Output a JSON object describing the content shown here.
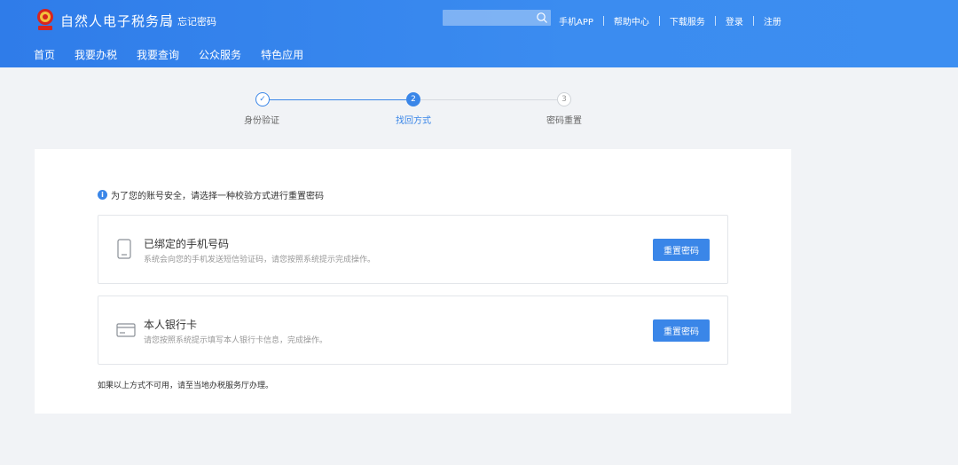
{
  "header": {
    "site_title": "自然人电子税务局",
    "sub_title": "忘记密码",
    "search": {
      "placeholder": ""
    },
    "top_links": [
      "手机APP",
      "帮助中心",
      "下载服务",
      "登录",
      "注册"
    ],
    "nav": [
      "首页",
      "我要办税",
      "我要查询",
      "公众服务",
      "特色应用"
    ]
  },
  "steps": {
    "items": [
      {
        "label": "身份验证",
        "marker": "✓",
        "state": "done"
      },
      {
        "label": "找回方式",
        "marker": "2",
        "state": "active"
      },
      {
        "label": "密码重置",
        "marker": "3",
        "state": "pending"
      }
    ]
  },
  "main": {
    "notice": "为了您的账号安全，请选择一种校验方式进行重置密码",
    "options": [
      {
        "icon": "phone-icon",
        "title": "已绑定的手机号码",
        "desc": "系统会向您的手机发送短信验证码，请您按照系统提示完成操作。",
        "button": "重置密码"
      },
      {
        "icon": "bank-card-icon",
        "title": "本人银行卡",
        "desc": "请您按照系统提示填写本人银行卡信息，完成操作。",
        "button": "重置密码"
      }
    ],
    "footnote": "如果以上方式不可用，请至当地办税服务厅办理。"
  },
  "colors": {
    "header_blue": "#2f7ce9",
    "accent": "#3a86e8",
    "step_pending": "#cfd3d8",
    "page_bg": "#f1f3f6"
  }
}
